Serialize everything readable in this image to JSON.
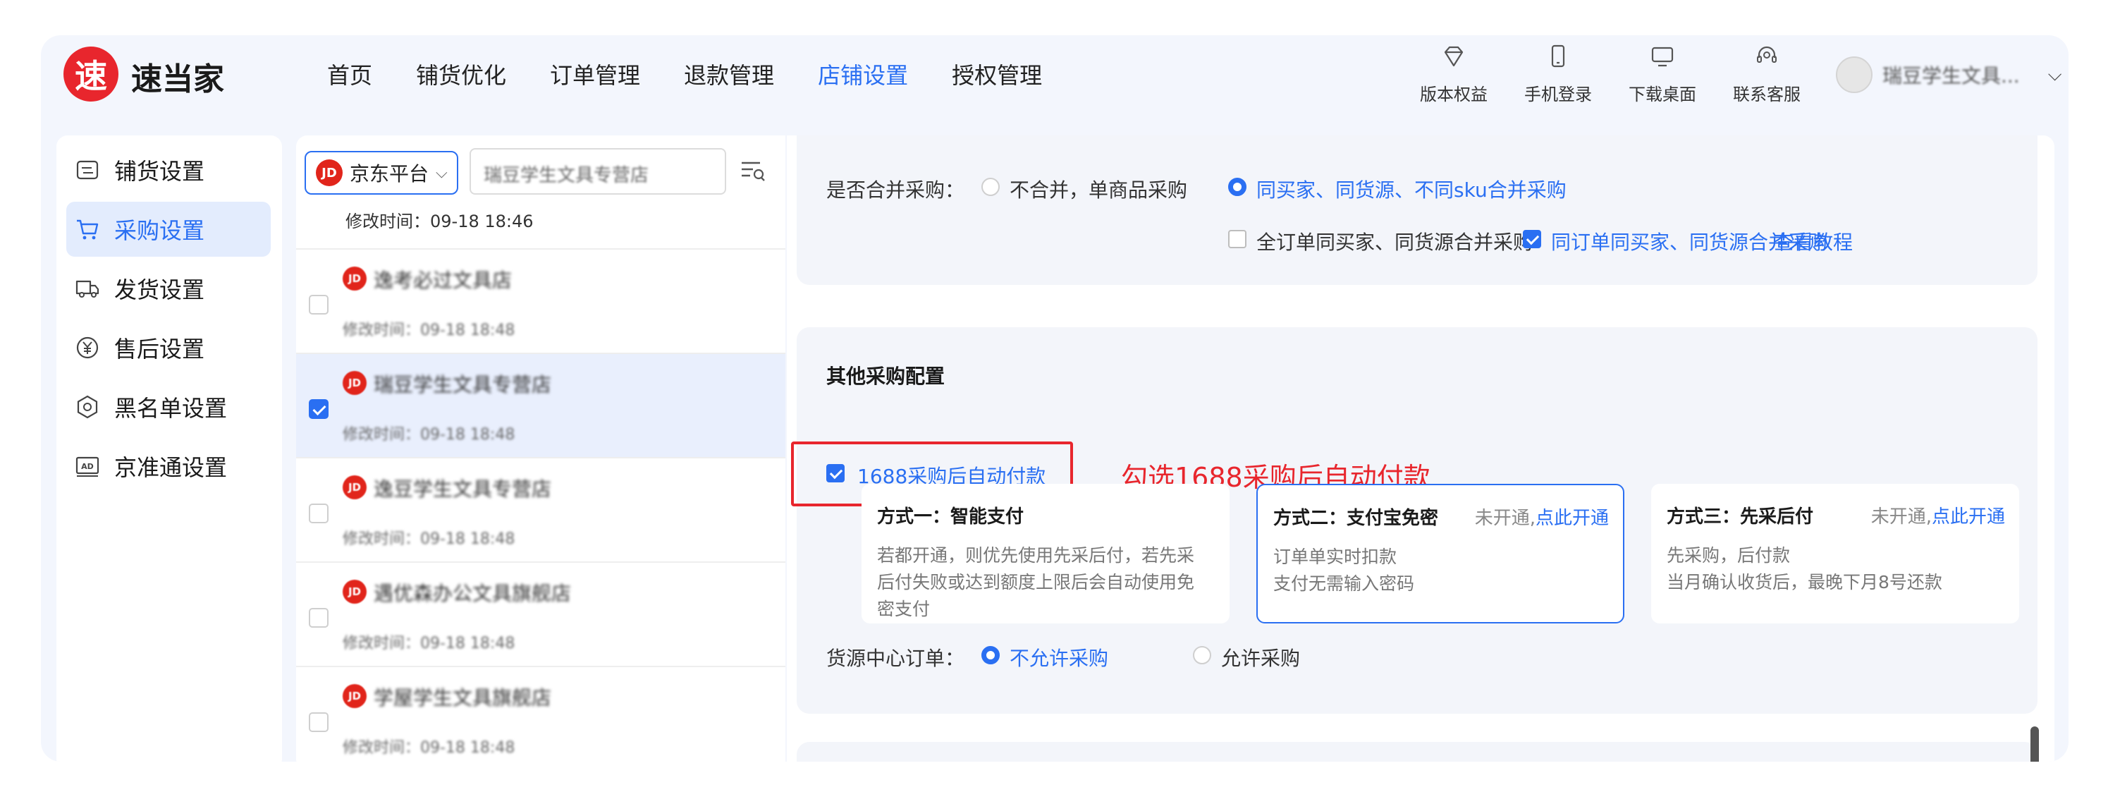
{
  "header": {
    "logo_char": "速",
    "brand": "速当家",
    "nav": [
      {
        "label": "首页",
        "active": false
      },
      {
        "label": "铺货优化",
        "active": false
      },
      {
        "label": "订单管理",
        "active": false
      },
      {
        "label": "退款管理",
        "active": false
      },
      {
        "label": "店铺设置",
        "active": true
      },
      {
        "label": "授权管理",
        "active": false
      }
    ],
    "tools": [
      {
        "label": "版本权益",
        "icon": "diamond-icon"
      },
      {
        "label": "手机登录",
        "icon": "phone-icon"
      },
      {
        "label": "下载桌面",
        "icon": "monitor-icon"
      },
      {
        "label": "联系客服",
        "icon": "headset-icon"
      }
    ],
    "user_name": "瑞豆学生文具..."
  },
  "sidebar": {
    "items": [
      {
        "label": "铺货设置",
        "icon": "distribution-icon",
        "active": false
      },
      {
        "label": "采购设置",
        "icon": "cart-icon",
        "active": true
      },
      {
        "label": "发货设置",
        "icon": "truck-icon",
        "active": false
      },
      {
        "label": "售后设置",
        "icon": "yen-icon",
        "active": false
      },
      {
        "label": "黑名单设置",
        "icon": "hexagon-icon",
        "active": false
      },
      {
        "label": "京准通设置",
        "icon": "ad-icon",
        "active": false
      }
    ]
  },
  "stores": {
    "platform_badge": "JD",
    "platform": "京东平台",
    "search_value": "瑞豆学生文具专营店",
    "current_modified": "修改时间：09-18 18:46",
    "rows": [
      {
        "name": "逸考必过文具店",
        "time": "修改时间：09-18 18:48",
        "selected": false
      },
      {
        "name": "瑞豆学生文具专营店",
        "time": "修改时间：09-18 18:48",
        "selected": true
      },
      {
        "name": "逸豆学生文具专营店",
        "time": "修改时间：09-18 18:48",
        "selected": false
      },
      {
        "name": "遇优森办公文具旗舰店",
        "time": "修改时间：09-18 18:48",
        "selected": false
      },
      {
        "name": "学屋学生文具旗舰店",
        "time": "修改时间：09-18 18:48",
        "selected": false
      }
    ]
  },
  "merge": {
    "label": "是否合并采购：",
    "option_no": "不合并，单商品采购",
    "option_yes": "同买家、同货源、不同sku合并采购",
    "selected": "yes",
    "check_all_orders": "全订单同买家、同货源合并采购",
    "check_all_orders_on": false,
    "check_same_order": "同订单同买家、同货源合并采购",
    "check_same_order_on": true,
    "tutorial_link": "查看教程"
  },
  "other": {
    "title": "其他采购配置",
    "auto_pay_label": "1688采购后自动付款",
    "auto_pay_on": true,
    "annotation": "勾选1688采购后自动付款",
    "methods": [
      {
        "title": "方式一：智能支付",
        "status": "",
        "link": "",
        "lines": [
          "若都开通，则优先使用先采后付，若先采",
          "后付失败或达到额度上限后会自动使用免",
          "密支付"
        ],
        "active": false
      },
      {
        "title": "方式二：支付宝免密",
        "status": "未开通,",
        "link": "点此开通",
        "lines": [
          "订单单实时扣款",
          "支付无需输入密码"
        ],
        "active": true
      },
      {
        "title": "方式三：先采后付",
        "status": "未开通,",
        "link": "点此开通",
        "lines": [
          "先采购，后付款",
          "当月确认收货后，最晚下月8号还款"
        ],
        "active": false
      }
    ],
    "source_label": "货源中心订单：",
    "source_no": "不允许采购",
    "source_yes": "允许采购",
    "source_selected": "no"
  },
  "colors": {
    "accent": "#2a6ff2",
    "brand_red": "#e8262d",
    "jd_red": "#e1251b"
  }
}
